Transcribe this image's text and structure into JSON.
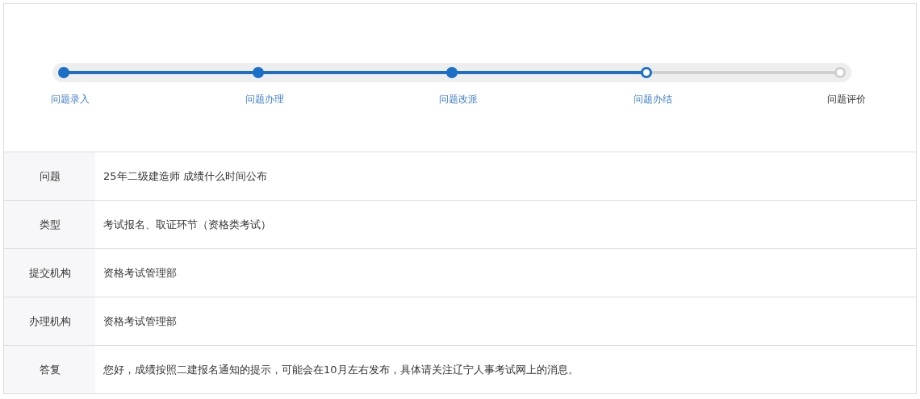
{
  "steps": [
    {
      "label": "问题录入",
      "completed": true,
      "current": false
    },
    {
      "label": "问题办理",
      "completed": true,
      "current": false
    },
    {
      "label": "问题改派",
      "completed": true,
      "current": false
    },
    {
      "label": "问题办结",
      "completed": false,
      "current": true
    },
    {
      "label": "问题评价",
      "completed": false,
      "current": false
    }
  ],
  "details": [
    {
      "label": "问题",
      "value": "25年二级建造师 成绩什么时间公布"
    },
    {
      "label": "类型",
      "value": "考试报名、取证环节（资格类考试）"
    },
    {
      "label": "提交机构",
      "value": "资格考试管理部"
    },
    {
      "label": "办理机构",
      "value": "资格考试管理部"
    },
    {
      "label": "答复",
      "value": "您好，成绩按照二建报名通知的提示，可能会在10月左右发布，具体请关注辽宁人事考试网上的消息。"
    }
  ]
}
